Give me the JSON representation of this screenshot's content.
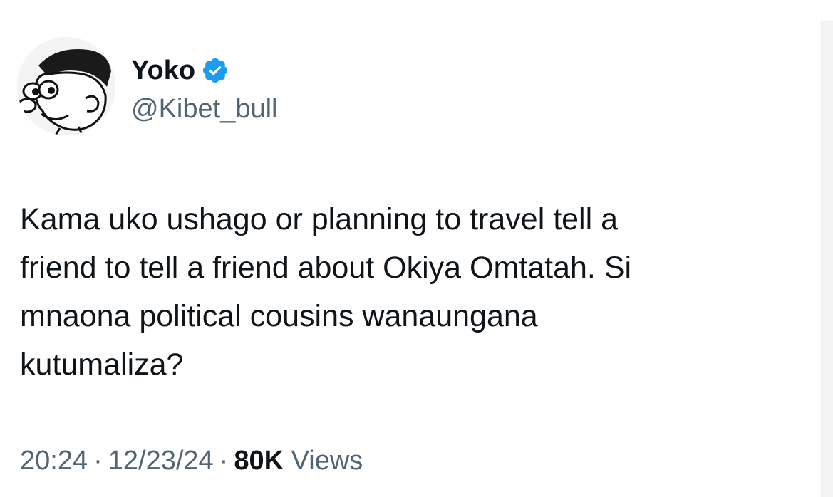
{
  "author": {
    "display_name": "Yoko",
    "handle": "@Kibet_bull",
    "verified_color": "#1d9bf0"
  },
  "tweet": {
    "text": "Kama uko ushago or planning to travel tell a\nfriend to tell a friend about Okiya Omtatah. Si\nmnaona political cousins wanaungana\nkutumaliza?"
  },
  "meta": {
    "time": "20:24",
    "separator": "·",
    "date": "12/23/24",
    "views_count": "80K",
    "views_label": "Views"
  },
  "colors": {
    "text_primary": "#0f1419",
    "text_secondary": "#536471",
    "background": "#ffffff"
  }
}
